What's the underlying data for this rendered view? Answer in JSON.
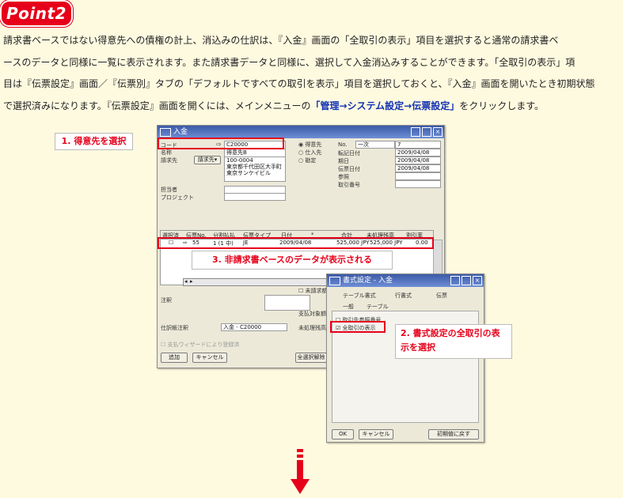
{
  "badge": "Point2",
  "paragraph": {
    "lines": [
      "請求書ベースではない得意先への債権の計上、消込みの仕訳は、『入金』画面の「全取引の表示」項目を選択すると通常の請求書ベ",
      "ースのデータと同様に一覧に表示されます。また請求書データと同様に、選択して入金消込みすることができます。「全取引の表示」項",
      "目は『伝票設定』画面／『伝票別』タブの「デフォルトですべての取引を表示」項目を選択しておくと、『入金』画面を開いたとき初期状態",
      "で選択済みになります。『伝票設定』画面を開くには、メインメニューの"
    ],
    "highlight": "「管理→システム設定→伝票設定」",
    "tail": "をクリックします。"
  },
  "callouts": {
    "c1": "1. 得意先を選択",
    "c2": "2. 書式設定の全取引の表示を選択",
    "c3": "3. 非請求書ベースのデータが表示される"
  },
  "payment_window": {
    "title": "入金",
    "labels": {
      "code": "コード",
      "name": "名称",
      "billto": "請求先",
      "billto_sel": "請求先▾",
      "person": "担当者",
      "project": "プロジェクト",
      "memo": "注釈",
      "journal_memo": "仕訳帳注釈",
      "wizard": "支払ウィザードにより登録済",
      "pay_target": "支払対象額",
      "unpaid": "未処理残高",
      "unbilled": "未請求額"
    },
    "values": {
      "code": "C20000",
      "name": "得意先B",
      "address": [
        "100-0004",
        "東京都千代田区大手町",
        "東京サンケイビル"
      ],
      "journal_memo": "入金 - C20000"
    },
    "radios": [
      "得意先",
      "仕入先",
      "勘定"
    ],
    "right_labels": [
      "No.",
      "転記日付",
      "期日",
      "伝票日付",
      "参照",
      "取引番号"
    ],
    "right_values": {
      "no_type": "一次",
      "no": "7",
      "posting": "2009/04/08",
      "due": "2009/04/08",
      "doc": "2009/04/08"
    },
    "table_headers": [
      "選択済",
      "伝票No.",
      "分割払払",
      "伝票タイプ",
      "日付",
      "*",
      "合計",
      "未処理残高",
      "割引率"
    ],
    "row": {
      "docno": "55",
      "split": "1 (1 中)",
      "type": "JE",
      "date": "2009/04/08",
      "total": "525,000 JPY",
      "balance": "525,000 JPY",
      "discount": "0.00"
    },
    "buttons": {
      "add": "追加",
      "cancel": "キャンセル",
      "all": "全選択解除"
    }
  },
  "format_window": {
    "title": "書式設定 - 入金",
    "tabs": [
      "テーブル書式",
      "行書式",
      "伝票"
    ],
    "subtabs": [
      "一般",
      "テーブル"
    ],
    "options": [
      "取引先参照番号",
      "全取引の表示"
    ],
    "buttons": {
      "ok": "OK",
      "cancel": "キャンセル",
      "reset": "初期値に戻す"
    }
  }
}
